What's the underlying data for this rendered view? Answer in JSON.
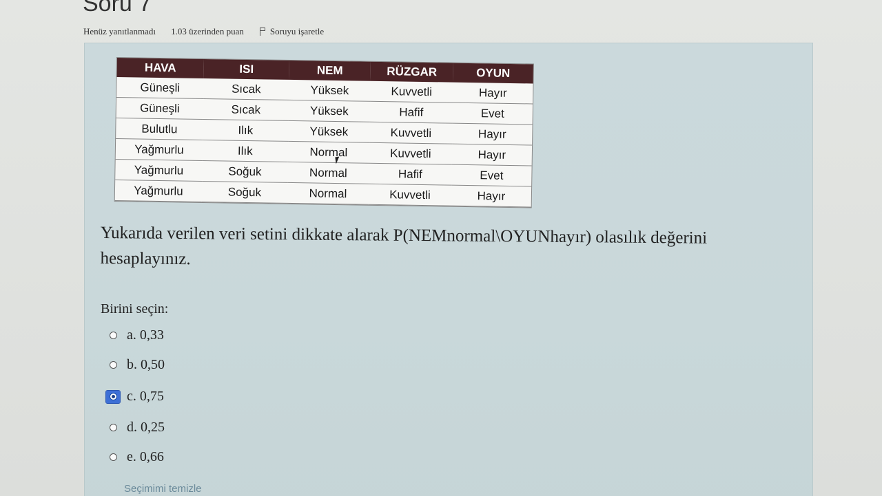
{
  "question": {
    "title": "Soru 7",
    "status": "Henüz yanıtlanmadı",
    "points": "1.03 üzerinden puan",
    "flag_label": "Soruyu işaretle",
    "text": "Yukarıda verilen veri setini dikkate alarak P(NEMnormal\\OYUNhayır) olasılık değerini hesaplayınız.",
    "choose_label": "Birini seçin:",
    "clear_label": "Seçimimi temizle"
  },
  "table": {
    "headers": [
      "HAVA",
      "ISI",
      "NEM",
      "RÜZGAR",
      "OYUN"
    ],
    "rows": [
      [
        "Güneşli",
        "Sıcak",
        "Yüksek",
        "Kuvvetli",
        "Hayır"
      ],
      [
        "Güneşli",
        "Sıcak",
        "Yüksek",
        "Hafif",
        "Evet"
      ],
      [
        "Bulutlu",
        "Ilık",
        "Yüksek",
        "Kuvvetli",
        "Hayır"
      ],
      [
        "Yağmurlu",
        "Ilık",
        "Normal",
        "Kuvvetli",
        "Hayır"
      ],
      [
        "Yağmurlu",
        "Soğuk",
        "Normal",
        "Hafif",
        "Evet"
      ],
      [
        "Yağmurlu",
        "Soğuk",
        "Normal",
        "Kuvvetli",
        "Hayır"
      ]
    ],
    "header_color": "#4a2326"
  },
  "options": [
    {
      "label": "a. 0,33",
      "checked": false
    },
    {
      "label": "b. 0,50",
      "checked": false
    },
    {
      "label": "c. 0,75",
      "checked": true
    },
    {
      "label": "d. 0,25",
      "checked": false
    },
    {
      "label": "e. 0,66",
      "checked": false
    }
  ],
  "icons": {
    "flag": "flag-icon",
    "cursor": "mouse-cursor-icon"
  }
}
